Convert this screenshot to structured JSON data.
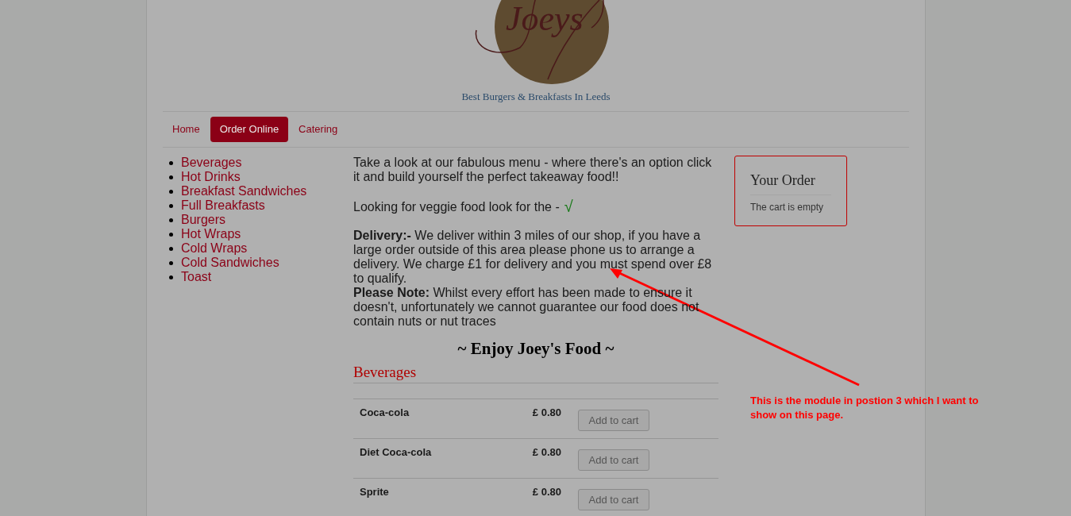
{
  "logo": {
    "text": "Joeys",
    "tagline": "Best Burgers & Breakfasts In Leeds"
  },
  "nav": [
    {
      "label": "Home",
      "selected": false
    },
    {
      "label": "Order Online",
      "selected": true
    },
    {
      "label": "Catering",
      "selected": false
    }
  ],
  "categories": [
    "Beverages",
    "Hot Drinks",
    "Breakfast Sandwiches",
    "Full Breakfasts",
    "Burgers",
    "Hot Wraps",
    "Cold Wraps",
    "Cold Sandwiches",
    "Toast"
  ],
  "intro": "Take a look at our fabulous menu - where there's an option click it and build yourself the perfect takeaway food!!",
  "veggie": {
    "text": "Looking for veggie food look for the -",
    "mark": "√"
  },
  "delivery": "**Delivery:-** We deliver within 3 miles of our shop, if you have a large order outside of this area please phone us to arrange a delivery. We charge £1 for delivery and you must spend over £8 to qualify.",
  "note": "**Please Note:** Whilst every effort has been made to ensure it doesn't, unfortunately we cannot guarantee our food does not contain nuts or nut traces",
  "enjoy": "~ Enjoy Joey's Food ~",
  "section": "Beverages",
  "items": [
    {
      "name": "Coca-cola",
      "price": "£ 0.80",
      "button": "Add to cart"
    },
    {
      "name": "Diet Coca-cola",
      "price": "£ 0.80",
      "button": "Add to cart"
    },
    {
      "name": "Sprite",
      "price": "£ 0.80",
      "button": "Add to cart"
    }
  ],
  "cart": {
    "title": "Your Order",
    "status": "The cart is empty"
  },
  "annotation": "This is the module in postion 3 which I want to show on this page."
}
